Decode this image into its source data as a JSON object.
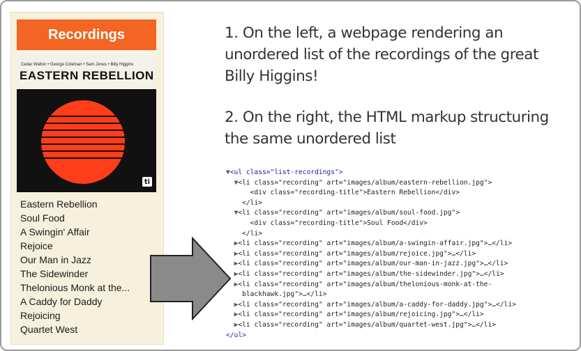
{
  "left_panel": {
    "header": "Recordings",
    "album": {
      "credits": "Cedar Walton • George Coleman • Sam Jones • Billy Higgins",
      "name": "EASTERN REBELLION",
      "logo": "ti"
    },
    "recordings": [
      "Eastern Rebellion",
      "Soul Food",
      "A Swingin' Affair",
      "Rejoice",
      "Our Man in Jazz",
      "The Sidewinder",
      "Thelonious Monk at the...",
      "A Caddy for Daddy",
      "Rejoicing",
      "Quartet West"
    ]
  },
  "description": {
    "point1": "1. On the left, a webpage rendering an unordered list of the recordings of the great Billy Higgins!",
    "point2": "2. On the right, the HTML markup structuring the same unordered list"
  },
  "code": {
    "ul_open": "<ul class=\"list-recordings\">",
    "ul_close": "</ul>",
    "expanded": [
      {
        "li_open": "<li class=\"recording\" art=\"images/album/eastern-rebellion.jpg\">",
        "div": "<div class=\"recording-title\">Eastern Rebellion</div>",
        "li_close": "</li>"
      },
      {
        "li_open": "<li class=\"recording\" art=\"images/album/soul-food.jpg\">",
        "div": "<div class=\"recording-title\">Soul Food</div>",
        "li_close": "</li>"
      }
    ],
    "collapsed": [
      "<li class=\"recording\" art=\"images/album/a-swingin-affair.jpg\">…</li>",
      "<li class=\"recording\" art=\"images/album/rejoice.jpg\">…</li>",
      "<li class=\"recording\" art=\"images/album/our-man-in-jazz.jpg\">…</li>",
      "<li class=\"recording\" art=\"images/album/the-sidewinder.jpg\">…</li>",
      "<li class=\"recording\" art=\"images/album/thelonious-monk-at-the-",
      "blackhawk.jpg\">…</li>",
      "<li class=\"recording\" art=\"images/album/a-caddy-for-daddy.jpg\">…</li>",
      "<li class=\"recording\" art=\"images/album/rejoicing.jpg\">…</li>",
      "<li class=\"recording\" art=\"images/album/quartet-west.jpg\">…</li>"
    ]
  },
  "colors": {
    "header_orange": "#f26522",
    "panel_bg": "#f6f0dc",
    "arrow_fill": "#8a8a8a"
  },
  "icons": [
    "expand-triangle-icon",
    "collapse-triangle-icon",
    "right-arrow-icon"
  ]
}
